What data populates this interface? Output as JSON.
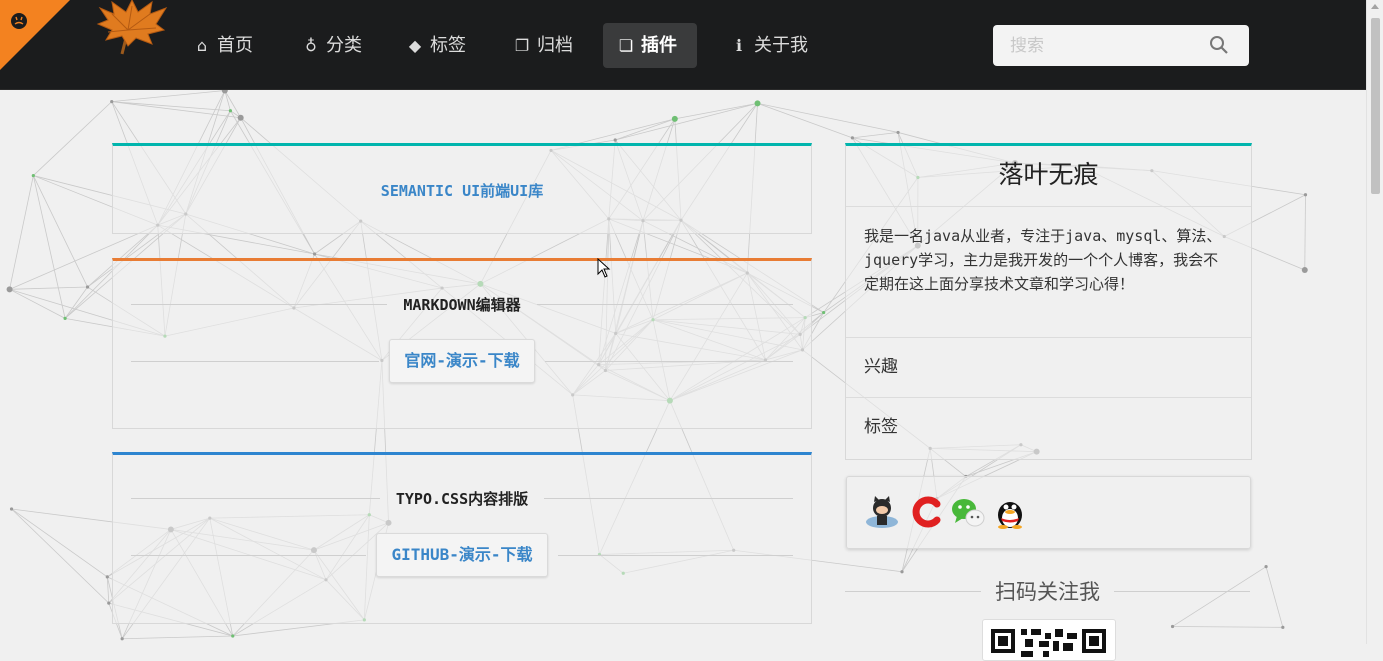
{
  "nav": {
    "items": [
      {
        "label": "首页",
        "icon": "home-icon",
        "active": false
      },
      {
        "label": "分类",
        "icon": "lightbulb-icon",
        "active": false
      },
      {
        "label": "标签",
        "icon": "tags-icon",
        "active": false
      },
      {
        "label": "归档",
        "icon": "clone-icon",
        "active": false
      },
      {
        "label": "插件",
        "icon": "copy-icon",
        "active": true
      },
      {
        "label": "关于我",
        "icon": "info-icon",
        "active": false
      }
    ],
    "search_placeholder": "搜索"
  },
  "plugins": [
    {
      "title": "SEMANTIC UI前端UI库",
      "accent": "#00b5ad"
    },
    {
      "title": "MARKDOWN编辑器",
      "links": "官网-演示-下载",
      "accent": "#e87c34"
    },
    {
      "title": "TYPO.CSS内容排版",
      "links": "GITHUB-演示-下载",
      "accent": "#2d85d0"
    }
  ],
  "sidebar": {
    "title": "落叶无痕",
    "description": "我是一名java从业者，专注于java、mysql、算法、jquery学习，主力是我开发的一个个人博客，我会不定期在这上面分享技术文章和学习心得！",
    "rows": [
      "兴趣",
      "标签"
    ],
    "social_icons": [
      "github-icon",
      "csdn-icon",
      "wechat-icon",
      "qq-icon"
    ],
    "qr_title": "扫码关注我"
  },
  "colors": {
    "nav_bg": "#1b1c1d",
    "github_corner": "#f38220",
    "link_blue": "#3a86c8",
    "teal": "#00b5ad",
    "orange": "#e87c34",
    "blue": "#2d85d0"
  }
}
